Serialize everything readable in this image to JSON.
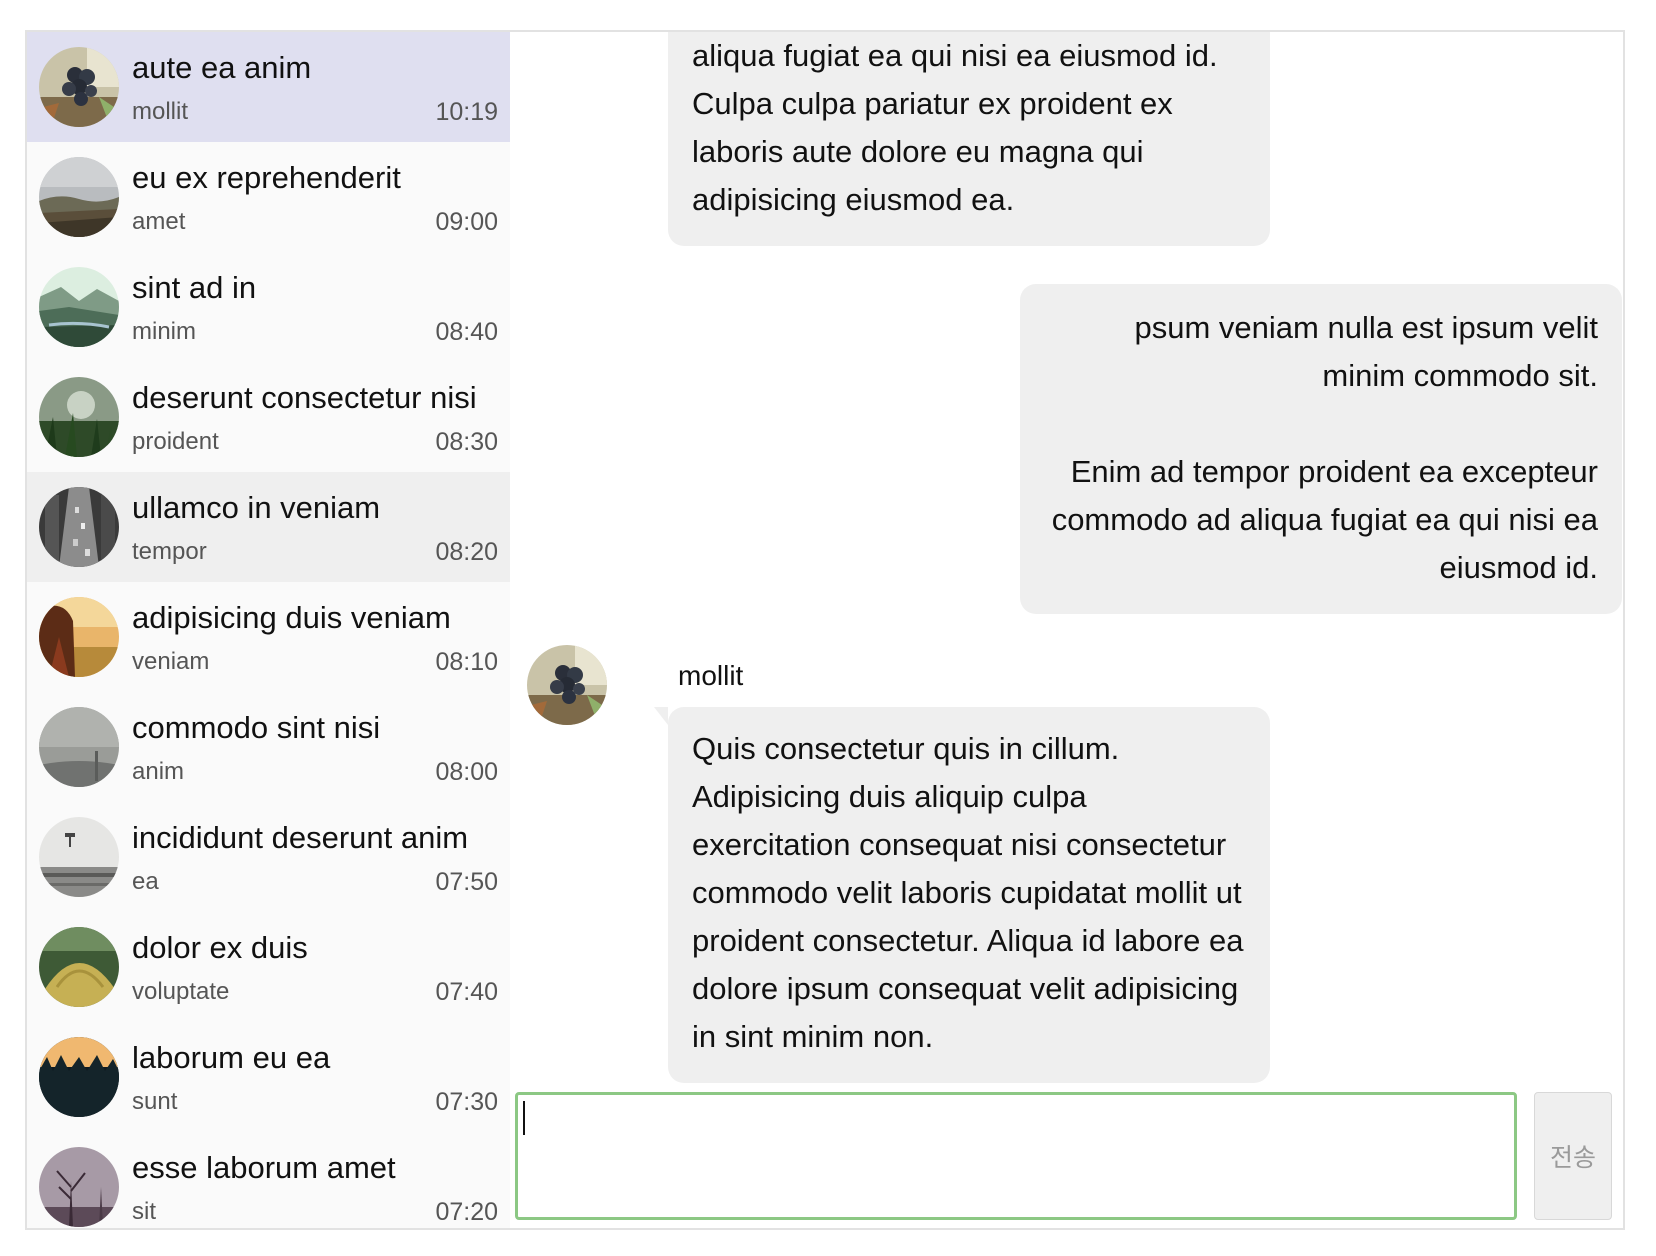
{
  "conversations": [
    {
      "name": "aute ea anim",
      "preview": "mollit",
      "time": "10:19",
      "avatar_icon": "grapes-photo-icon"
    },
    {
      "name": "eu ex reprehenderit",
      "preview": "amet",
      "time": "09:00",
      "avatar_icon": "field-sky-photo-icon"
    },
    {
      "name": "sint ad in",
      "preview": "minim",
      "time": "08:40",
      "avatar_icon": "valley-photo-icon"
    },
    {
      "name": "deserunt consectetur nisi",
      "preview": "proident",
      "time": "08:30",
      "avatar_icon": "grass-photo-icon"
    },
    {
      "name": "ullamco in veniam",
      "preview": "tempor",
      "time": "08:20",
      "avatar_icon": "street-photo-icon"
    },
    {
      "name": "adipisicing duis veniam",
      "preview": "veniam",
      "time": "08:10",
      "avatar_icon": "sunset-girl-photo-icon"
    },
    {
      "name": "commodo sint nisi",
      "preview": "anim",
      "time": "08:00",
      "avatar_icon": "fog-photo-icon"
    },
    {
      "name": "incididunt deserunt anim",
      "preview": "ea",
      "time": "07:50",
      "avatar_icon": "wall-photo-icon"
    },
    {
      "name": "dolor ex duis",
      "preview": "voluptate",
      "time": "07:40",
      "avatar_icon": "haystack-photo-icon"
    },
    {
      "name": "laborum eu ea",
      "preview": "sunt",
      "time": "07:30",
      "avatar_icon": "forest-dusk-photo-icon"
    },
    {
      "name": "esse laborum amet",
      "preview": "sit",
      "time": "07:20",
      "avatar_icon": "trees-photo-icon"
    }
  ],
  "messages": [
    {
      "text": "aliqua fugiat ea qui nisi ea eiusmod id. Culpa culpa pariatur ex proident ex laboris aute dolore eu magna qui adipisicing eiusmod ea."
    },
    {
      "paragraphs": [
        "psum veniam nulla est ipsum velit minim commodo sit.",
        "Enim ad tempor proident ea excepteur commodo ad aliqua fugiat ea qui nisi ea eiusmod id."
      ]
    },
    {
      "sender": "mollit",
      "text": "Quis consectetur quis in cillum. Adipisicing duis aliquip culpa exercitation consequat nisi consectetur commodo velit laboris cupidatat mollit ut proident consectetur. Aliqua id labore ea dolore ipsum consequat velit adipisicing in sint minim non."
    }
  ],
  "composer": {
    "value": "",
    "send_label": "전송"
  },
  "colors": {
    "selected_row": "#dfdff0",
    "hover_row": "#efefef",
    "bubble": "#efefef",
    "composer_border": "#8cc884"
  }
}
